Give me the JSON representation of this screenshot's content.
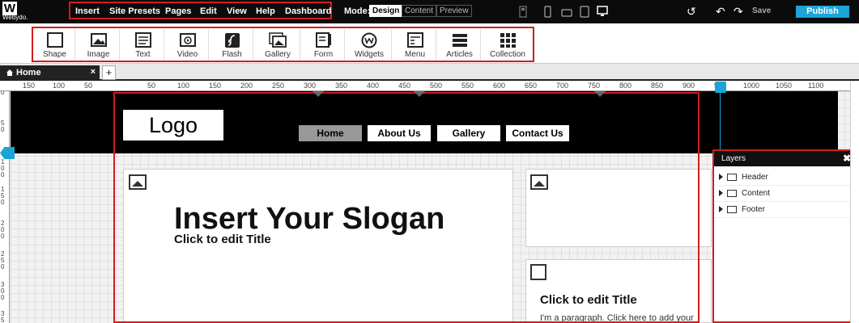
{
  "brand": {
    "mark": "W",
    "name": "Webydo."
  },
  "menu": [
    "Insert",
    "Site Presets",
    "Pages",
    "Edit",
    "View",
    "Help",
    "Dashboard"
  ],
  "mode": {
    "label": "Mode:",
    "options": [
      "Design",
      "Content",
      "Preview"
    ],
    "active": "Design"
  },
  "actions": {
    "save": "Save",
    "publish": "Publish"
  },
  "colors": {
    "accent": "#1aa4d7",
    "highlight": "#d21c1c",
    "topbar": "#0b0b0b"
  },
  "tools": [
    {
      "label": "Shape",
      "icon": "shape-icon"
    },
    {
      "label": "Image",
      "icon": "image-icon"
    },
    {
      "label": "Text",
      "icon": "text-icon"
    },
    {
      "label": "Video",
      "icon": "video-icon"
    },
    {
      "label": "Flash",
      "icon": "flash-icon"
    },
    {
      "label": "Gallery",
      "icon": "gallery-icon"
    },
    {
      "label": "Form",
      "icon": "form-icon"
    },
    {
      "label": "Widgets",
      "icon": "widgets-icon"
    },
    {
      "label": "Menu",
      "icon": "menu-icon"
    },
    {
      "label": "Articles",
      "icon": "articles-icon"
    },
    {
      "label": "Collection",
      "icon": "collection-icon"
    }
  ],
  "tab": {
    "label": "Home",
    "close": "×",
    "add": "+"
  },
  "ruler": {
    "neg": [
      "150",
      "100",
      "50"
    ],
    "pos": [
      "50",
      "100",
      "150",
      "200",
      "250",
      "300",
      "350",
      "400",
      "450",
      "500",
      "550",
      "600",
      "650",
      "700",
      "750",
      "800",
      "850",
      "900",
      "950",
      "1000",
      "1050",
      "1100"
    ],
    "vertical": [
      "0",
      "50",
      "100",
      "150",
      "200",
      "250",
      "300",
      "350"
    ]
  },
  "site": {
    "logo": "Logo",
    "nav": [
      "Home",
      "About Us",
      "Gallery",
      "Contact Us"
    ],
    "slogan": "Insert Your Slogan",
    "subtitle": "Click to edit Title",
    "right_title": "Click to edit Title",
    "right_paragraph": "I'm a paragraph. Click here to add your"
  },
  "layers": {
    "title": "Layers",
    "items": [
      "Header",
      "Content",
      "Footer"
    ]
  }
}
